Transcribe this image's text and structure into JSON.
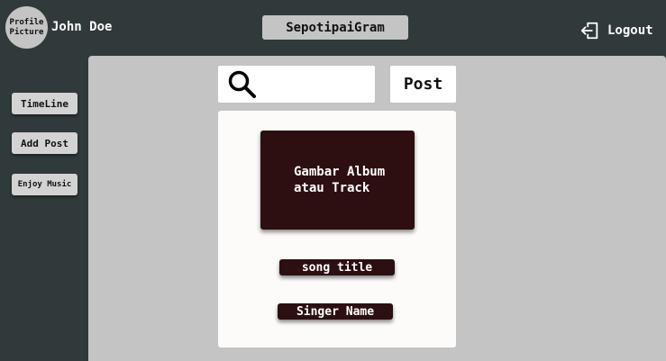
{
  "header": {
    "avatar_line1": "Profile",
    "avatar_line2": "Picture",
    "username": "John Doe",
    "app_title": "SepotipaiGram",
    "logout_label": "Logout",
    "logout_icon": "logout-icon"
  },
  "sidebar": {
    "items": [
      {
        "label": "TimeLine"
      },
      {
        "label": "Add Post"
      },
      {
        "label": "Enjoy Music"
      }
    ]
  },
  "main": {
    "search": {
      "icon": "search-icon",
      "value": "",
      "placeholder": ""
    },
    "post_label": "Post",
    "card": {
      "album_text": "Gambar Album\natau Track",
      "song_title": "song title",
      "singer_name": "Singer Name"
    }
  },
  "colors": {
    "background": "#313a3a",
    "panel": "#c4c4c4",
    "card": "#fcfbfa",
    "accent_dark": "#2d0f11"
  }
}
